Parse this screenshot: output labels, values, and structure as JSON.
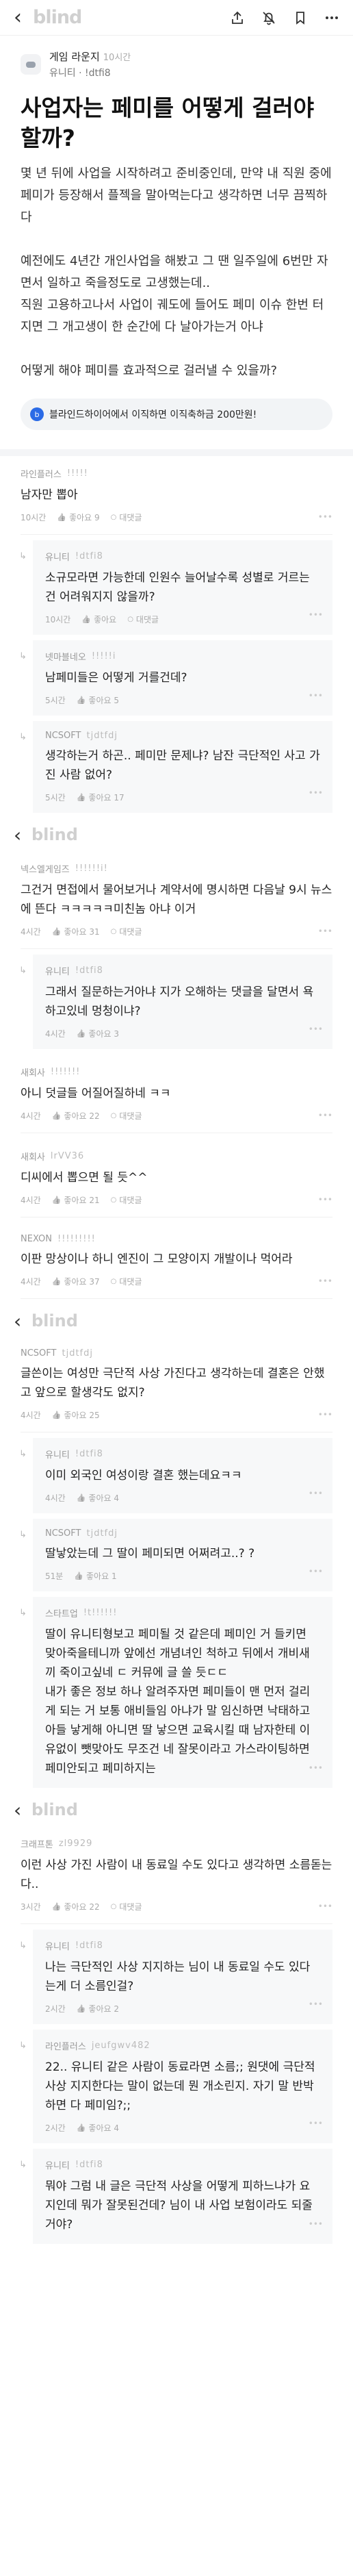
{
  "header": {
    "logo": "blind"
  },
  "post": {
    "channel": "게임 라운지",
    "time": "10시간",
    "company": "유니티",
    "nick": "!dtfi8",
    "title": "사업자는 페미를 어떻게 걸러야할까?",
    "body": "몇 년 뒤에 사업을 시작하려고 준비중인데, 만약 내 직원 중에 페미가 등장해서 플젝을 말아먹는다고 생각하면 너무 끔찍하다\n\n예전에도 4년간 개인사업을 해봤고 그 땐 일주일에 6번만 자면서 일하고 죽을정도로 고생했는데..\n직원 고용하고나서 사업이 궤도에 들어도 페미 이슈 한번 터지면 그 개고생이 한 순간에 다 날아가는거 아냐\n\n어떻게 해야 페미를 효과적으로 걸러낼 수 있을까?",
    "banner": "블라인드하이어에서 이직하면 이직축하금 200만원!"
  },
  "comments": [
    {
      "company": "라인플러스",
      "nick": "!!!!!",
      "text": "남자만 뽑아",
      "time": "10시간",
      "likes": "좋아요 9",
      "reply": "대댓글"
    },
    {
      "company": "유니티",
      "nick": "!dtfi8",
      "text": "소규모라면 가능한데 인원수 늘어날수록 성별로 거르는건 어려워지지 않을까?",
      "time": "10시간",
      "likes": "좋아요",
      "reply": "대댓글",
      "child": true
    },
    {
      "company": "넷마블네오",
      "nick": "!!!!!i",
      "text": "남페미들은 어떻게 거를건데?",
      "time": "5시간",
      "likes": "좋아요 5",
      "reply": "",
      "child": true
    },
    {
      "company": "NCSOFT",
      "nick": "tjdtfdj",
      "text": "생각하는거 하곤.. 페미만 문제냐? 남잔 극단적인 사고 가진 사람 없어?",
      "time": "5시간",
      "likes": "좋아요 17",
      "reply": "",
      "child": true
    }
  ],
  "comments2": [
    {
      "company": "넥스엘게임즈",
      "nick": "!!!!!!i!",
      "text": "그건거 면접에서 물어보거나 계약서에 명시하면 다음날 9시 뉴스에 뜬다 ㅋㅋㅋㅋㅋ미친놈 아냐 이거",
      "time": "4시간",
      "likes": "좋아요 31",
      "reply": "대댓글"
    },
    {
      "company": "유니티",
      "nick": "!dtfi8",
      "text": "그래서 질문하는거아냐 지가 오해하는 댓글을 달면서 욕하고있네 멍청이냐?",
      "time": "4시간",
      "likes": "좋아요 3",
      "reply": "",
      "child": true
    },
    {
      "company": "새회사",
      "nick": "!!!!!!!",
      "text": "아니 덧글들 어질어질하네 ㅋㅋ",
      "time": "4시간",
      "likes": "좋아요 22",
      "reply": "대댓글"
    },
    {
      "company": "새회사",
      "nick": "lrVV36",
      "text": "디씨에서 뽑으면 될 듯^^",
      "time": "4시간",
      "likes": "좋아요 21",
      "reply": "대댓글"
    },
    {
      "company": "NEXON",
      "nick": "!!!!!!!!!",
      "text": "이판 망상이나 하니 엔진이 그 모양이지 개발이나 먹어라",
      "time": "4시간",
      "likes": "좋아요 37",
      "reply": "대댓글"
    }
  ],
  "comments3": [
    {
      "company": "NCSOFT",
      "nick": "tjdtfdj",
      "text": "글쓴이는 여성만 극단적 사상 가진다고 생각하는데 결혼은 안했고 앞으로 할생각도 없지?",
      "time": "4시간",
      "likes": "좋아요 25",
      "reply": ""
    },
    {
      "company": "유니티",
      "nick": "!dtfi8",
      "text": "이미 외국인 여성이랑 결혼 했는데요ㅋㅋ",
      "time": "4시간",
      "likes": "좋아요 4",
      "reply": "",
      "child": true
    },
    {
      "company": "NCSOFT",
      "nick": "tjdtfdj",
      "text": "딸낳았는데 그 딸이 페미되면 어쩌려고..? ?",
      "time": "51분",
      "likes": "좋아요 1",
      "reply": "",
      "child": true
    },
    {
      "company": "스타트업",
      "nick": "!t!!!!!!",
      "text": "딸이 유니티형보고 페미될 것 같은데 페미인 거 들키면 맞아죽을테니까 앞에선 개념녀인 척하고 뒤에서 개비새끼 죽이고싶네 ㄷ 커뮤에 글 쓸 듯ㄷㄷ\n내가 좋은 정보 하나 알려주자면 페미들이 맨 먼저 걸리게 되는 거 보통 애비들임 아냐가 말 임신하면 낙태하고 아들 낳게해 아니면 딸 낳으면 교육시킬 때 남자한테 이유없이 뺏맞아도 무조건 네 잘못이라고 가스라이팅하면 페미안되고 페미하지는",
      "time": "",
      "likes": "",
      "reply": "",
      "child": true
    }
  ],
  "comments4": [
    {
      "company": "크래프톤",
      "nick": "zl9929",
      "text": "이런 사상 가진 사람이 내 동료일 수도 있다고 생각하면 소름돋는다..",
      "time": "3시간",
      "likes": "좋아요 22",
      "reply": "대댓글"
    },
    {
      "company": "유니티",
      "nick": "!dtfi8",
      "text": "나는 극단적인 사상 지지하는 님이 내 동료일 수도 있다는게 더 소름인걸?",
      "time": "2시간",
      "likes": "좋아요 2",
      "reply": "",
      "child": true
    },
    {
      "company": "라인플러스",
      "nick": "jeufgwv482",
      "text": "22.. 유니티 같은 사람이 동료라면 소름;; 원댓에 극단적 사상 지지한다는 말이 없는데 뭔 개소린지. 자기 말 반박하면 다 페미임?;;",
      "time": "2시간",
      "likes": "좋아요 4",
      "reply": "",
      "child": true
    },
    {
      "company": "유니티",
      "nick": "!dtfi8",
      "text": "뭐야 그럼 내 글은 극단적 사상을 어떻게 피하느냐가 요지인데 뭐가 잘못된건데? 님이 내 사업 보험이라도 되줄거야?",
      "time": "",
      "likes": "",
      "reply": "",
      "child": true
    }
  ]
}
